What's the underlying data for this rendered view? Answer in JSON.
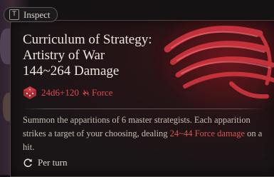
{
  "inspect": {
    "key": "T",
    "label": "Inspect"
  },
  "spell": {
    "title_line1": "Curriculum of Strategy:",
    "title_line2": "Artistry of War",
    "title_line3": "144~264 Damage",
    "dice": "24d6+120",
    "damage_type": "Force",
    "desc_part1": "Summon the apparitions of 6 master strategists. Each apparition strikes a target of your choosing, dealing ",
    "desc_highlight1": "24~44",
    "desc_space": " ",
    "desc_highlight2": "Force damage",
    "desc_part2": " on a hit.",
    "usage": "Per turn"
  },
  "colors": {
    "accent_red": "#e04a48",
    "text": "#ece6de",
    "desc": "#c7beb4"
  },
  "icons": {
    "dice": "d20-dice-icon",
    "force": "force-damage-icon",
    "turn": "per-turn-icon",
    "art": "claw-art-icon"
  }
}
